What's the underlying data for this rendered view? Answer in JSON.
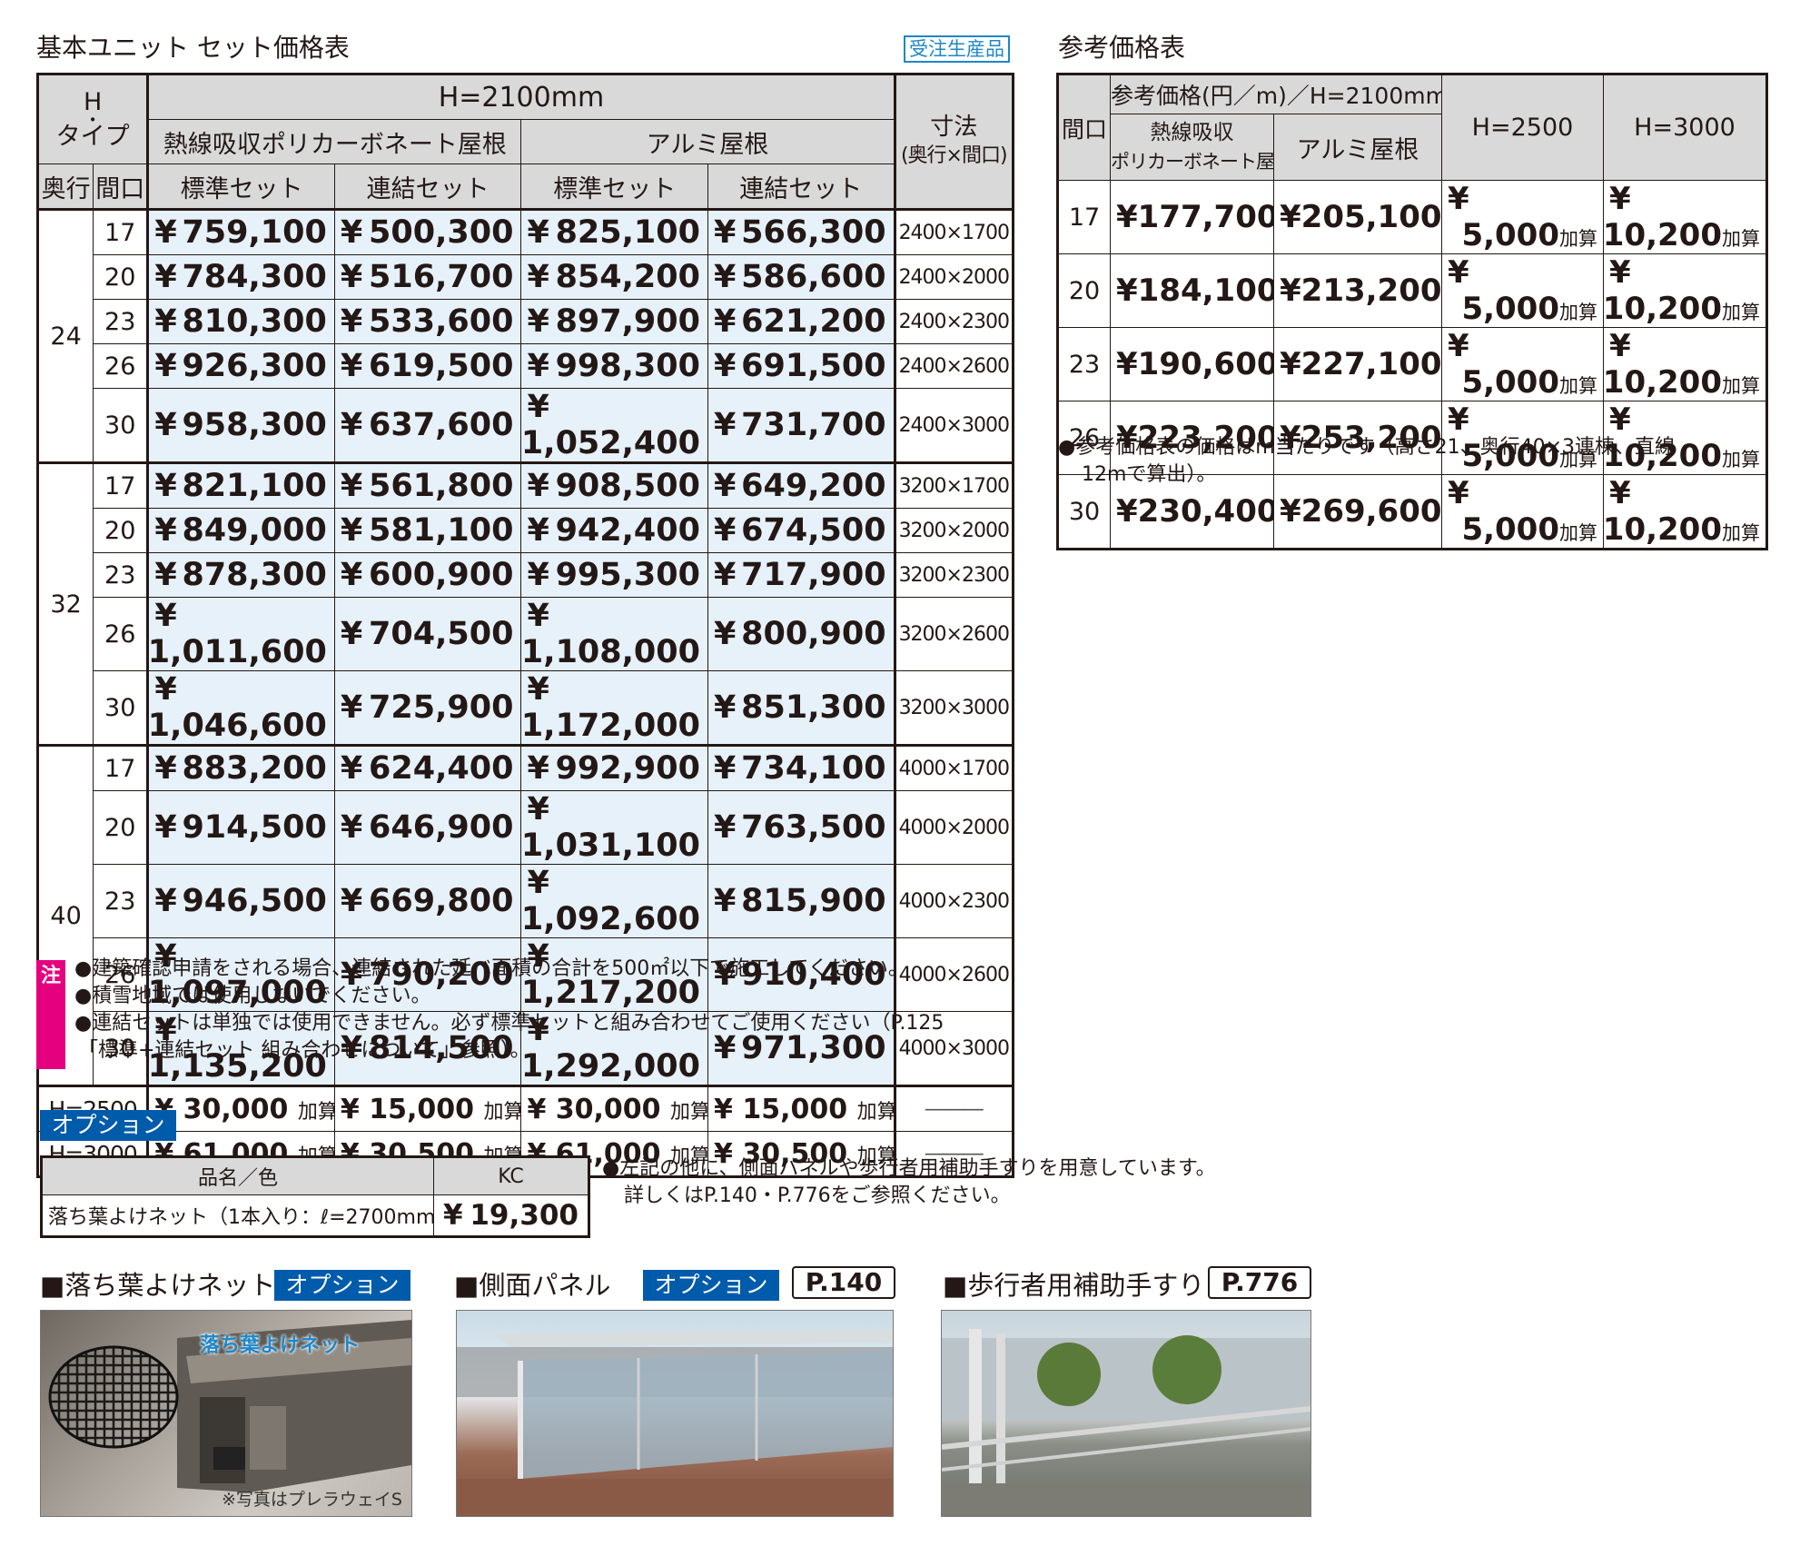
{
  "main_title": "基本ユニット セット価格表",
  "made_to_order": "受注生産品",
  "main_table": {
    "h_type_h": "H",
    "h_type_dot": "・",
    "h_type_label": "タイプ",
    "h_height": "H=2100mm",
    "roof_poly": "熱線吸収ポリカーボネート屋根",
    "roof_alu": "アルミ屋根",
    "set_std": "標準セット",
    "set_link": "連結セット",
    "depth_label": "奥行",
    "width_label": "間口",
    "dim_label": "寸法",
    "dim_sub": "(奥行×間口)",
    "yen": "¥",
    "groups": [
      {
        "depth": "24",
        "rows": [
          {
            "w": "17",
            "p": [
              "759,100",
              "500,300",
              "825,100",
              "566,300"
            ],
            "dim": "2400×1700"
          },
          {
            "w": "20",
            "p": [
              "784,300",
              "516,700",
              "854,200",
              "586,600"
            ],
            "dim": "2400×2000"
          },
          {
            "w": "23",
            "p": [
              "810,300",
              "533,600",
              "897,900",
              "621,200"
            ],
            "dim": "2400×2300"
          },
          {
            "w": "26",
            "p": [
              "926,300",
              "619,500",
              "998,300",
              "691,500"
            ],
            "dim": "2400×2600"
          },
          {
            "w": "30",
            "p": [
              "958,300",
              "637,600",
              "1,052,400",
              "731,700"
            ],
            "dim": "2400×3000"
          }
        ]
      },
      {
        "depth": "32",
        "rows": [
          {
            "w": "17",
            "p": [
              "821,100",
              "561,800",
              "908,500",
              "649,200"
            ],
            "dim": "3200×1700"
          },
          {
            "w": "20",
            "p": [
              "849,000",
              "581,100",
              "942,400",
              "674,500"
            ],
            "dim": "3200×2000"
          },
          {
            "w": "23",
            "p": [
              "878,300",
              "600,900",
              "995,300",
              "717,900"
            ],
            "dim": "3200×2300"
          },
          {
            "w": "26",
            "p": [
              "1,011,600",
              "704,500",
              "1,108,000",
              "800,900"
            ],
            "dim": "3200×2600"
          },
          {
            "w": "30",
            "p": [
              "1,046,600",
              "725,900",
              "1,172,000",
              "851,300"
            ],
            "dim": "3200×3000"
          }
        ]
      },
      {
        "depth": "40",
        "rows": [
          {
            "w": "17",
            "p": [
              "883,200",
              "624,400",
              "992,900",
              "734,100"
            ],
            "dim": "4000×1700"
          },
          {
            "w": "20",
            "p": [
              "914,500",
              "646,900",
              "1,031,100",
              "763,500"
            ],
            "dim": "4000×2000"
          },
          {
            "w": "23",
            "p": [
              "946,500",
              "669,800",
              "1,092,600",
              "815,900"
            ],
            "dim": "4000×2300"
          },
          {
            "w": "26",
            "p": [
              "1,097,000",
              "790,200",
              "1,217,200",
              "910,400"
            ],
            "dim": "4000×2600"
          },
          {
            "w": "30",
            "p": [
              "1,135,200",
              "814,500",
              "1,292,000",
              "971,300"
            ],
            "dim": "4000×3000"
          }
        ]
      }
    ],
    "add_rows": [
      {
        "label": "H=2500",
        "p": [
          "30,000",
          "15,000",
          "30,000",
          "15,000"
        ],
        "suffix": "加算",
        "dash": "―――"
      },
      {
        "label": "H=3000",
        "p": [
          "61,000",
          "30,500",
          "61,000",
          "30,500"
        ],
        "suffix": "加算",
        "dash": "―――"
      }
    ]
  },
  "notes": {
    "mark": "注",
    "items": [
      "●建築確認申請をされる場合、連結された延べ面積の合計を500㎡以下で施工してください。",
      "●積雪地域では使用しないでください。",
      "●連結セットは単独では使用できません。必ず標準セットと組み合わせてご使用ください（P.125",
      "「標準+連結セット 組み合わせについて」参照）。"
    ]
  },
  "ref_title": "参考価格表",
  "ref_table": {
    "width_label": "間口",
    "ref_header": "参考価格(円／m)／H=2100mm",
    "poly_line1": "熱線吸収",
    "poly_line2": "ポリカーボネート屋根",
    "alu": "アルミ屋根",
    "h2500": "H=2500",
    "h3000": "H=3000",
    "yen": "¥",
    "suffix": "加算",
    "rows": [
      {
        "w": "17",
        "p": [
          "177,700",
          "205,100",
          "5,000",
          "10,200"
        ]
      },
      {
        "w": "20",
        "p": [
          "184,100",
          "213,200",
          "5,000",
          "10,200"
        ]
      },
      {
        "w": "23",
        "p": [
          "190,600",
          "227,100",
          "5,000",
          "10,200"
        ]
      },
      {
        "w": "26",
        "p": [
          "223,200",
          "253,200",
          "5,000",
          "10,200"
        ]
      },
      {
        "w": "30",
        "p": [
          "230,400",
          "269,600",
          "5,000",
          "10,200"
        ]
      }
    ]
  },
  "ref_note_1": "●参考価格表の価格はm当たりです（高さ21、奥行40×3連棟、直線",
  "ref_note_2": "12mで算出）。",
  "option": {
    "badge": "オプション",
    "col_name": "品名／色",
    "col_kc": "KC",
    "item": "落ち葉よけネット（1本入り：ℓ=2700mm）",
    "yen": "¥",
    "price": "19,300",
    "note_1": "●左記の他に、側面パネルや歩行者用補助手すりを用意しています。",
    "note_2": "詳しくはP.140・P.776をご参照ください。"
  },
  "photos": [
    {
      "title": "■落ち葉よけネット",
      "badge": "オプション",
      "ref": "",
      "label": "落ち葉よけネット",
      "caption": "※写真はプレラウェイS"
    },
    {
      "title": "■側面パネル",
      "badge": "オプション",
      "ref": "P.140"
    },
    {
      "title": "■歩行者用補助手すり",
      "badge": "",
      "ref": "P.776"
    }
  ]
}
